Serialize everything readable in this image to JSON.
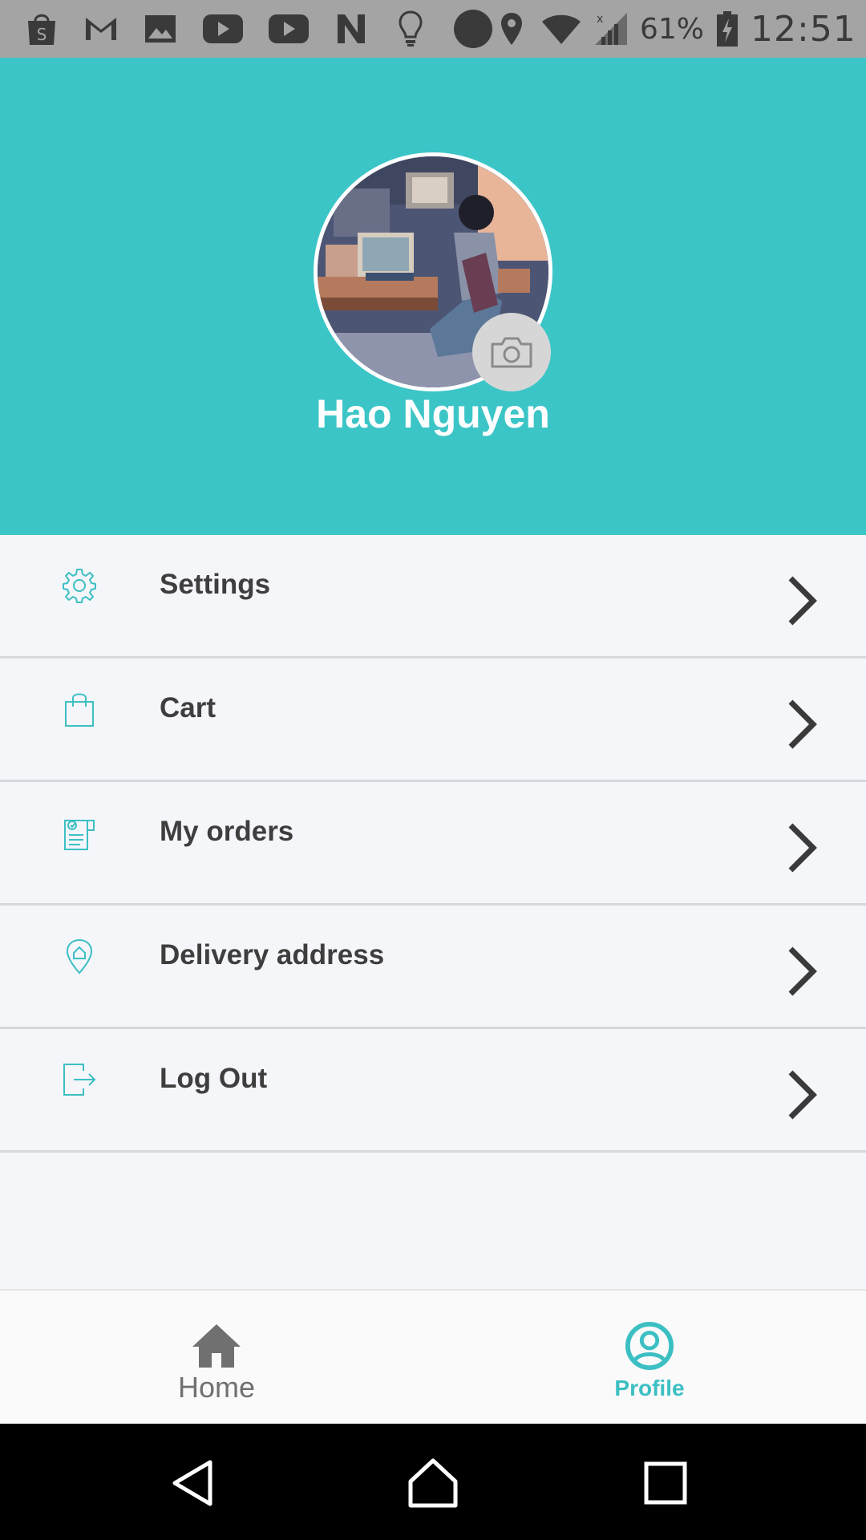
{
  "status_bar": {
    "battery": "61%",
    "time": "12:51",
    "icons": [
      "shopee-icon",
      "gmail-icon",
      "gallery-icon",
      "youtube-icon",
      "youtube-icon",
      "n-icon",
      "bulb-icon",
      "circle-icon",
      "location-icon",
      "wifi-icon",
      "signal-icon",
      "battery-charging-icon"
    ]
  },
  "header": {
    "background": "#3cc5c7",
    "name": "Hao Nguyen"
  },
  "menu": {
    "items": [
      {
        "label": "Settings",
        "icon": "gear-icon"
      },
      {
        "label": "Cart",
        "icon": "shopping-bag-icon"
      },
      {
        "label": "My orders",
        "icon": "receipt-icon"
      },
      {
        "label": "Delivery address",
        "icon": "home-location-icon"
      },
      {
        "label": "Log Out",
        "icon": "logout-icon"
      }
    ]
  },
  "bottom_nav": {
    "home_label": "Home",
    "profile_label": "Profile",
    "active": "Profile",
    "active_color": "#3cbfc3"
  }
}
